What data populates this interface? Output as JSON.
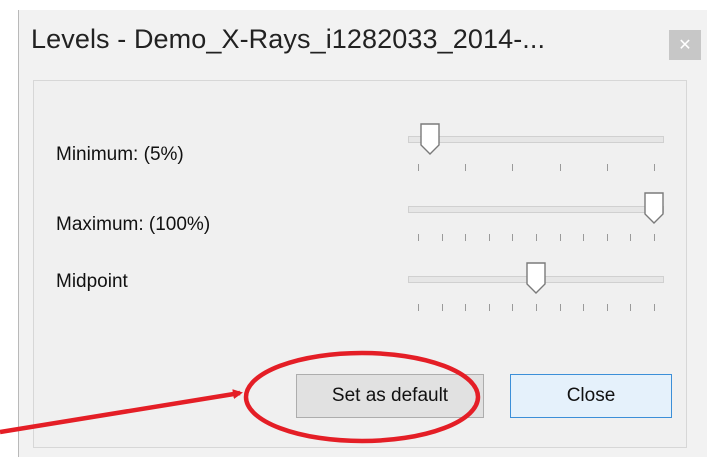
{
  "window": {
    "title": "Levels - Demo_X-Rays_i1282033_2014-...",
    "close_icon": "close-icon"
  },
  "sliders": [
    {
      "label": "Minimum: (5%)",
      "value_percent": 5,
      "tick_count": 6
    },
    {
      "label": "Maximum: (100%)",
      "value_percent": 100,
      "tick_count": 11
    },
    {
      "label": "Midpoint",
      "value_percent": 50,
      "tick_count": 11
    }
  ],
  "buttons": {
    "set_default": "Set as default",
    "close": "Close"
  },
  "colors": {
    "annotation_red": "#e41e26",
    "focus_blue": "#3c8fd8"
  }
}
